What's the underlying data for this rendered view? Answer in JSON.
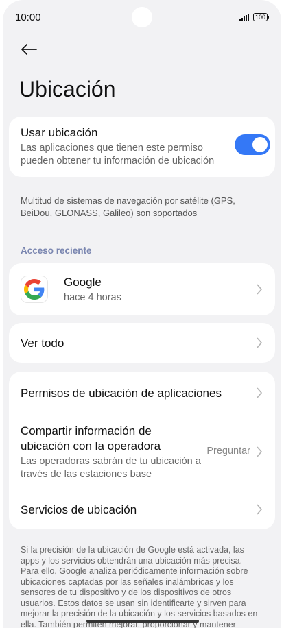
{
  "status_bar": {
    "time": "10:00",
    "battery": "100"
  },
  "page": {
    "title": "Ubicación"
  },
  "use_location": {
    "title": "Usar ubicación",
    "description": "Las aplicaciones que tienen este permiso pueden obtener tu información de ubicación",
    "enabled": true
  },
  "gnss_info": "Multitud de sistemas de navegación por satélite (GPS, BeiDou, GLONASS, Galileo) son soportados",
  "recent_access": {
    "header": "Acceso reciente",
    "apps": [
      {
        "name": "Google",
        "time": "hace 4 horas",
        "icon": "google-icon"
      }
    ]
  },
  "see_all": "Ver todo",
  "settings": {
    "app_permissions": "Permisos de ubicación de aplicaciones",
    "carrier_share": {
      "title": "Compartir información de ubicación con la operadora",
      "description": "Las operadoras sabrán de tu ubicación a través de las estaciones base",
      "value": "Preguntar"
    },
    "location_services": "Servicios de ubicación"
  },
  "footer": "Si la precisión de la ubicación de Google está activada, las apps y los servicios obtendrán una ubicación más precisa. Para ello, Google analiza periódicamente información sobre ubicaciones captadas por las señales inalámbricas y los sensores de tu dispositivo y de los dispositivos de otros usuarios. Estos datos se usan sin identificarte y sirven para mejorar la precisión de la ubicación y los servicios basados en ella. También permiten mejorar, proporcionar y mantener",
  "colors": {
    "accent": "#3478f6",
    "background": "#f2f2f4",
    "section_header": "#7a86b0"
  }
}
